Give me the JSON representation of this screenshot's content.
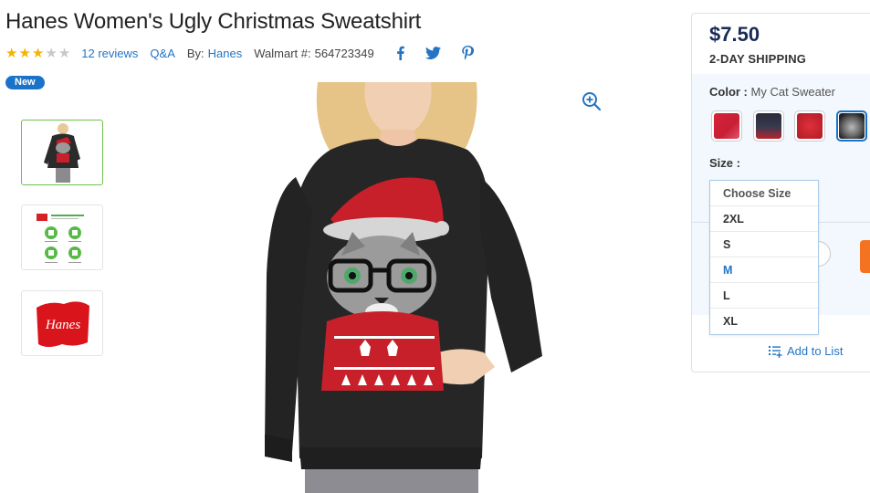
{
  "product": {
    "title": "Hanes Women's Ugly Christmas Sweatshirt",
    "rating": 3,
    "rating_max": 5,
    "reviews_label": "12 reviews",
    "qa_label": "Q&A",
    "by_label": "By:",
    "brand": "Hanes",
    "walmart_label": "Walmart #:",
    "walmart_number": "564723349",
    "badge": "New"
  },
  "social": {
    "icons": [
      "facebook-icon",
      "twitter-icon",
      "pinterest-icon"
    ],
    "color": "#2374c5"
  },
  "gallery": {
    "thumbnails": [
      {
        "name": "thumbnail-cat-sweater",
        "selected": true
      },
      {
        "name": "thumbnail-hanes-infographic",
        "selected": false
      },
      {
        "name": "thumbnail-hanes-logo",
        "selected": false
      }
    ],
    "logo_text": "Hanes",
    "zoom_icon": "zoom-in-icon"
  },
  "offer": {
    "price": "$7.50",
    "shipping": "2-DAY SHIPPING",
    "color_label": "Color :",
    "color_value": "My Cat Sweater",
    "size_label": "Size :",
    "add_to_list": "Add to List",
    "accent": "#1a73c9",
    "cart_color": "#f47321"
  },
  "swatches": [
    {
      "name": "swatch-red-christmas",
      "selected": false
    },
    {
      "name": "swatch-behave-black",
      "selected": false
    },
    {
      "name": "swatch-red-hoho",
      "selected": false
    },
    {
      "name": "swatch-my-cat-sweater",
      "selected": true
    }
  ],
  "size_dropdown": {
    "options": [
      "Choose Size",
      "2XL",
      "S",
      "M",
      "L",
      "XL"
    ],
    "highlighted": "M"
  }
}
